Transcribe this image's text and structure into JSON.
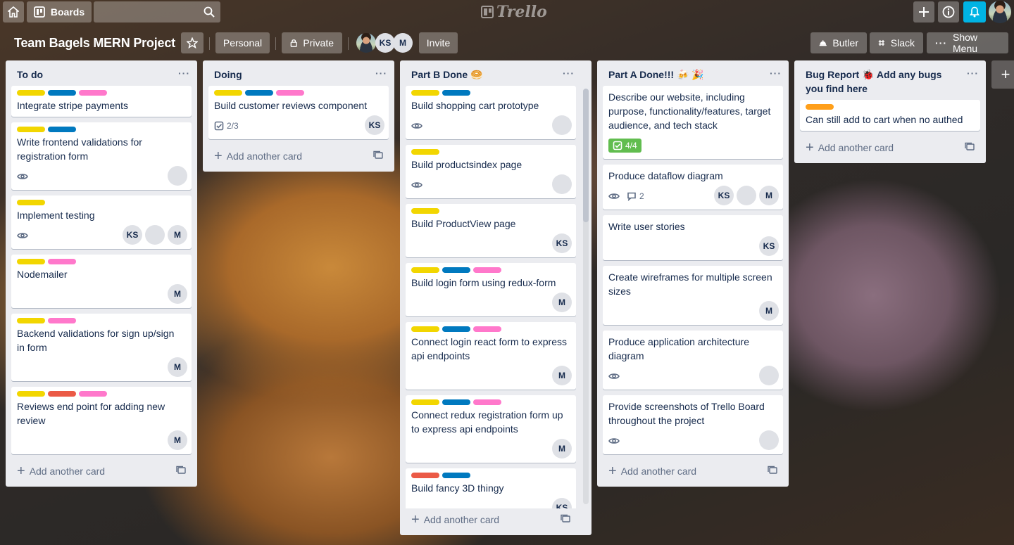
{
  "topbar": {
    "boards_label": "Boards",
    "logo_text": "Trello"
  },
  "board": {
    "title": "Team Bagels MERN Project",
    "visibility_team": "Personal",
    "visibility_privacy": "Private",
    "members": [
      "KS",
      "M"
    ],
    "invite_label": "Invite",
    "butler_label": "Butler",
    "slack_label": "Slack",
    "show_menu_label": "Show Menu"
  },
  "colors": {
    "yellow": "#f2d600",
    "blue": "#0079bf",
    "pink": "#ff78cb",
    "red": "#eb5a46",
    "orange": "#ff9f1a",
    "green": "#61bd4f",
    "notification": "#00b3e3"
  },
  "add_card_label": "Add another card",
  "lists": [
    {
      "title": "To do",
      "cards": [
        {
          "labels": [
            "yellow",
            "blue",
            "pink"
          ],
          "title": "Integrate stripe payments"
        },
        {
          "labels": [
            "yellow",
            "blue"
          ],
          "title": "Write frontend validations for registration form",
          "watch": true,
          "members": [
            "photo"
          ]
        },
        {
          "labels": [
            "yellow"
          ],
          "title": "Implement testing",
          "watch": true,
          "members": [
            "KS",
            "photo",
            "M"
          ]
        },
        {
          "labels": [
            "yellow",
            "pink"
          ],
          "title": "Nodemailer",
          "members": [
            "M"
          ]
        },
        {
          "labels": [
            "yellow",
            "pink"
          ],
          "title": "Backend validations for sign up/sign in form",
          "members": [
            "M"
          ]
        },
        {
          "labels": [
            "yellow",
            "red",
            "pink"
          ],
          "title": "Reviews end point for adding new review",
          "members": [
            "M"
          ]
        }
      ]
    },
    {
      "title": "Doing",
      "cards": [
        {
          "labels": [
            "yellow",
            "blue",
            "pink"
          ],
          "title": "Build customer reviews component",
          "checklist": "2/3",
          "members": [
            "KS"
          ]
        }
      ]
    },
    {
      "title": "Part B Done 🥯",
      "cards": [
        {
          "labels": [
            "yellow",
            "blue"
          ],
          "title": "Build shopping cart prototype",
          "watch": true,
          "members": [
            "photo"
          ]
        },
        {
          "labels": [
            "yellow"
          ],
          "title": "Build productsindex page",
          "watch": true,
          "members": [
            "photo"
          ]
        },
        {
          "labels": [
            "yellow"
          ],
          "title": "Build ProductView page",
          "members": [
            "KS"
          ]
        },
        {
          "labels": [
            "yellow",
            "blue",
            "pink"
          ],
          "title": "Build login form using redux-form",
          "members": [
            "M"
          ]
        },
        {
          "labels": [
            "yellow",
            "blue",
            "pink"
          ],
          "title": "Connect login react form to express api endpoints",
          "members": [
            "M"
          ]
        },
        {
          "labels": [
            "yellow",
            "blue",
            "pink"
          ],
          "title": "Connect redux registration form up to express api endpoints",
          "members": [
            "M"
          ]
        },
        {
          "labels": [
            "red",
            "blue"
          ],
          "title": "Build fancy 3D thingy",
          "members": [
            "KS"
          ]
        }
      ]
    },
    {
      "title": "Part A Done!!! 🍻 🎉",
      "cards": [
        {
          "labels": [],
          "title": "Describe our website, including purpose, functionality/features, target audience, and tech stack",
          "checklist_done": "4/4"
        },
        {
          "labels": [],
          "title": "Produce dataflow diagram",
          "watch": true,
          "comments": "2",
          "members": [
            "KS",
            "photo",
            "M"
          ]
        },
        {
          "labels": [],
          "title": "Write user stories",
          "members": [
            "KS"
          ]
        },
        {
          "labels": [],
          "title": "Create wireframes for multiple screen sizes",
          "members": [
            "M"
          ]
        },
        {
          "labels": [],
          "title": "Produce application architecture diagram",
          "watch": true,
          "members": [
            "photo"
          ]
        },
        {
          "labels": [],
          "title": "Provide screenshots of Trello Board throughout the project",
          "watch": true,
          "members": [
            "photo"
          ]
        }
      ]
    },
    {
      "title": "Bug Report 🐞 Add any bugs you find here",
      "cards": [
        {
          "labels": [
            "orange"
          ],
          "title": "Can still add to cart when no authed"
        }
      ]
    }
  ]
}
